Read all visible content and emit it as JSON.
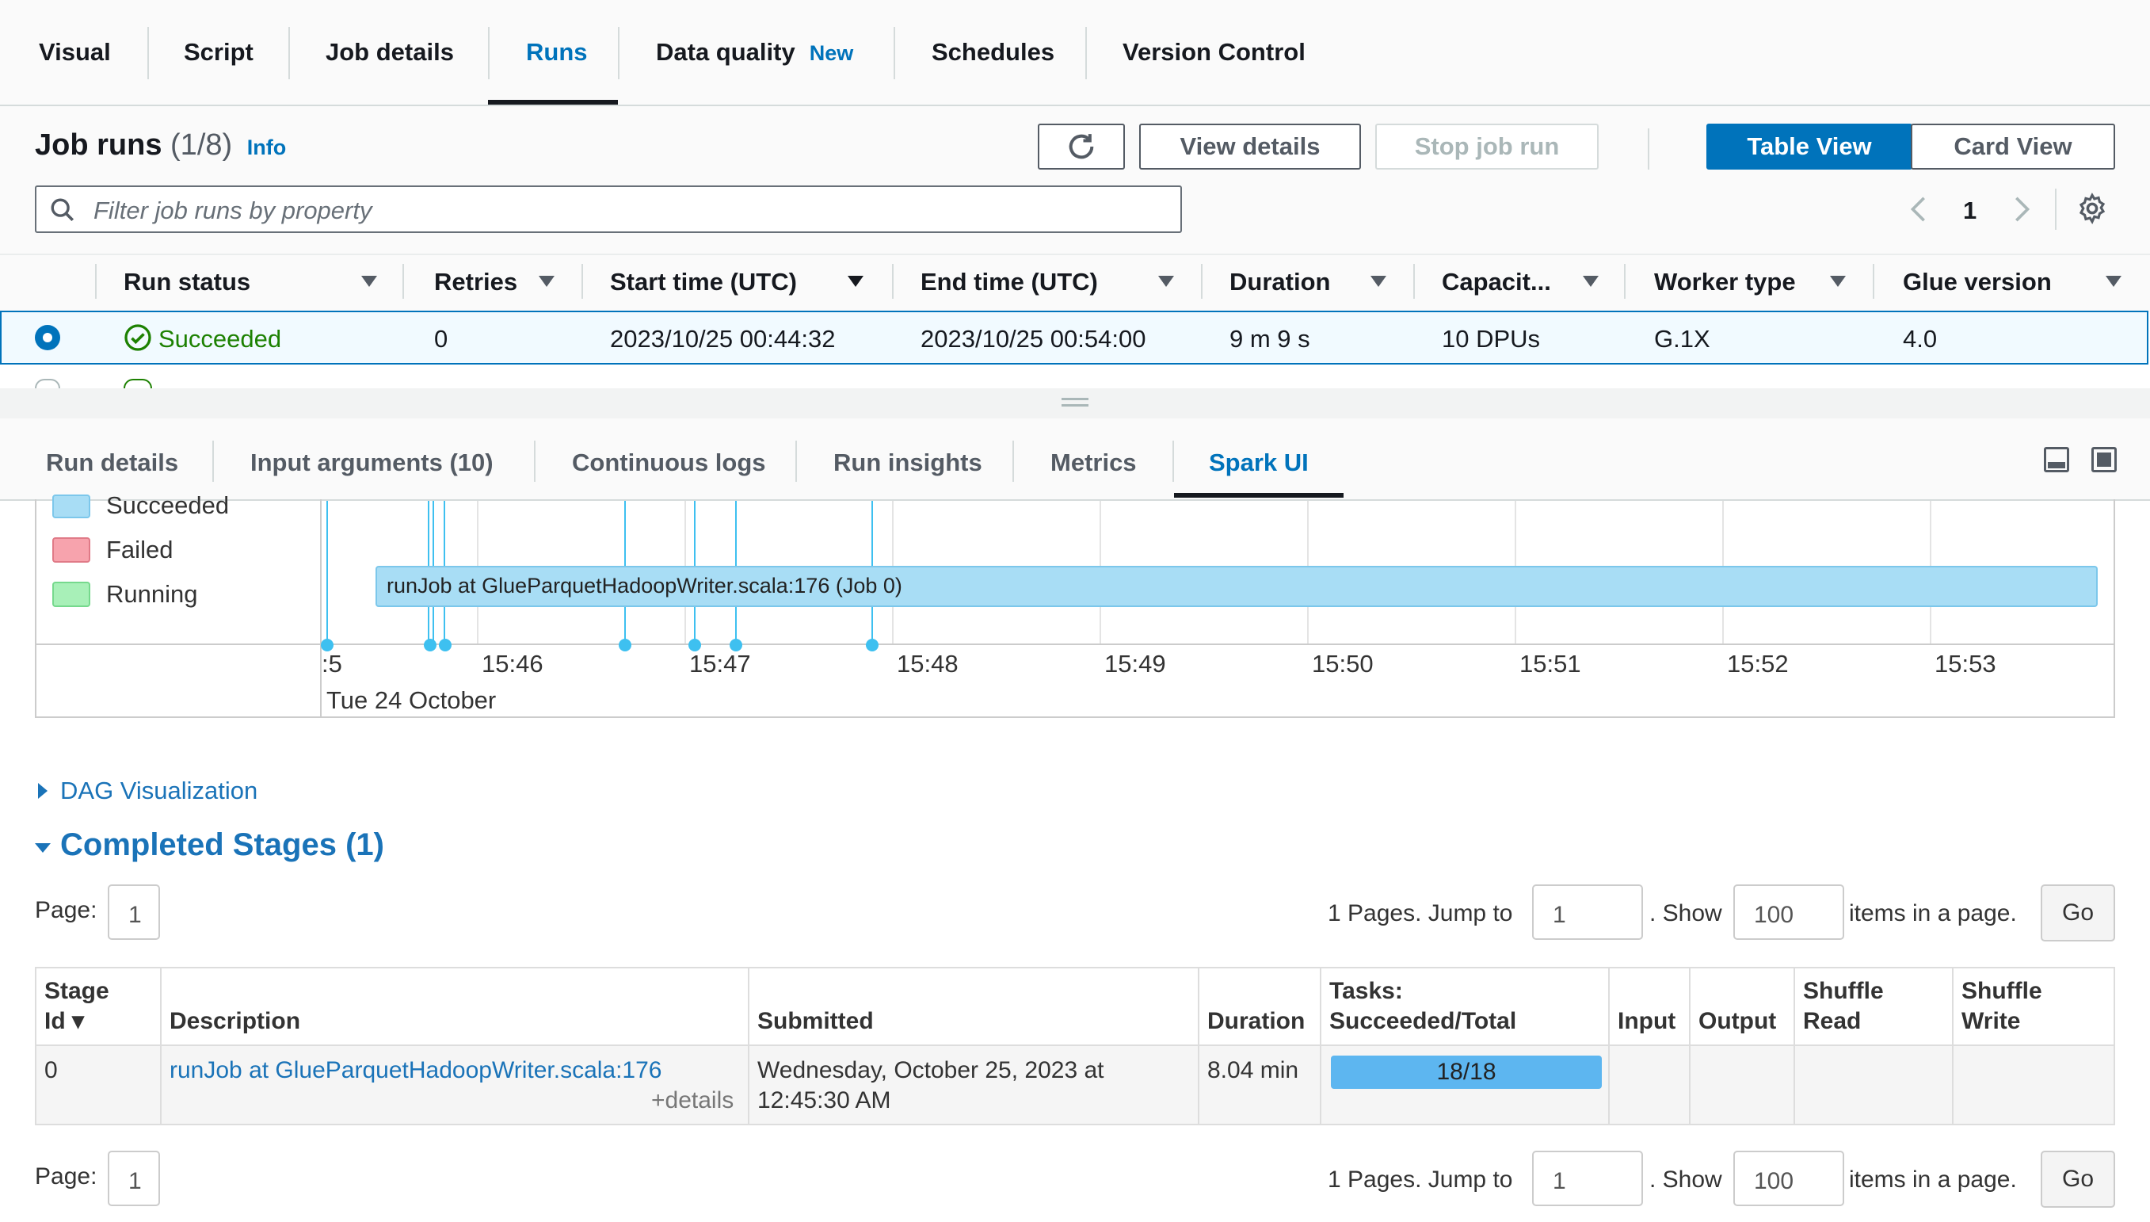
{
  "top_tabs": [
    {
      "label": "Visual"
    },
    {
      "label": "Script"
    },
    {
      "label": "Job details"
    },
    {
      "label": "Runs"
    },
    {
      "label": "Data quality",
      "badge": "New"
    },
    {
      "label": "Schedules"
    },
    {
      "label": "Version Control"
    }
  ],
  "active_top_tab": "Runs",
  "job_runs": {
    "title": "Job runs",
    "count": "(1/8)",
    "info": "Info",
    "buttons": {
      "view_details": "View details",
      "stop_job_run": "Stop job run",
      "table_view": "Table View",
      "card_view": "Card View"
    },
    "filter_placeholder": "Filter job runs by property",
    "page": "1"
  },
  "runs_table": {
    "headers": [
      "Run status",
      "Retries",
      "Start time (UTC)",
      "End time (UTC)",
      "Duration",
      "Capacit...",
      "Worker type",
      "Glue version"
    ],
    "rows": [
      {
        "status": "Succeeded",
        "retries": "0",
        "start": "2023/10/25 00:44:32",
        "end": "2023/10/25 00:54:00",
        "duration": "9 m 9 s",
        "capacity": "10 DPUs",
        "worker": "G.1X",
        "version": "4.0"
      }
    ]
  },
  "bottom_tabs": [
    {
      "label": "Run details"
    },
    {
      "label": "Input arguments (10)"
    },
    {
      "label": "Continuous logs"
    },
    {
      "label": "Run insights"
    },
    {
      "label": "Metrics"
    },
    {
      "label": "Spark UI"
    }
  ],
  "active_bottom_tab": "Spark UI",
  "timeline": {
    "legend": [
      "Succeeded",
      "Failed",
      "Running"
    ],
    "legend_colors": [
      "#a8ddf5",
      "#f7a3ad",
      "#a8f0b8"
    ],
    "job_bar": "runJob at GlueParquetHadoopWriter.scala:176 (Job 0)",
    "time_labels": [
      ":5",
      "15:46",
      "15:47",
      "15:48",
      "15:49",
      "15:50",
      "15:51",
      "15:52",
      "15:53"
    ],
    "date_label": "Tue 24 October"
  },
  "dag": {
    "label": "DAG Visualization"
  },
  "stages": {
    "title": "Completed Stages (1)",
    "page_label": "Page:",
    "page_value": "1",
    "pages_text": "1 Pages. Jump to",
    "jump_value": "1",
    "show_text": ". Show",
    "show_value": "100",
    "items_text": "items in a page.",
    "go": "Go",
    "headers": {
      "stage_id_1": "Stage",
      "stage_id_2": "Id ▾",
      "description": "Description",
      "submitted": "Submitted",
      "duration": "Duration",
      "tasks_1": "Tasks:",
      "tasks_2": "Succeeded/Total",
      "input": "Input",
      "output": "Output",
      "shuffle_read_1": "Shuffle",
      "shuffle_read_2": "Read",
      "shuffle_write_1": "Shuffle",
      "shuffle_write_2": "Write"
    },
    "rows": [
      {
        "stage_id": "0",
        "description": "runJob at GlueParquetHadoopWriter.scala:176",
        "details": "+details",
        "submitted_1": "Wednesday, October 25, 2023 at",
        "submitted_2": "12:45:30 AM",
        "duration": "8.04 min",
        "tasks": "18/18",
        "tasks_fraction": 1.0
      }
    ]
  },
  "colors": {
    "accent": "#0073bb",
    "success": "#1d8102",
    "spark_link": "#1a73b8",
    "bar": "#a8ddf5"
  }
}
